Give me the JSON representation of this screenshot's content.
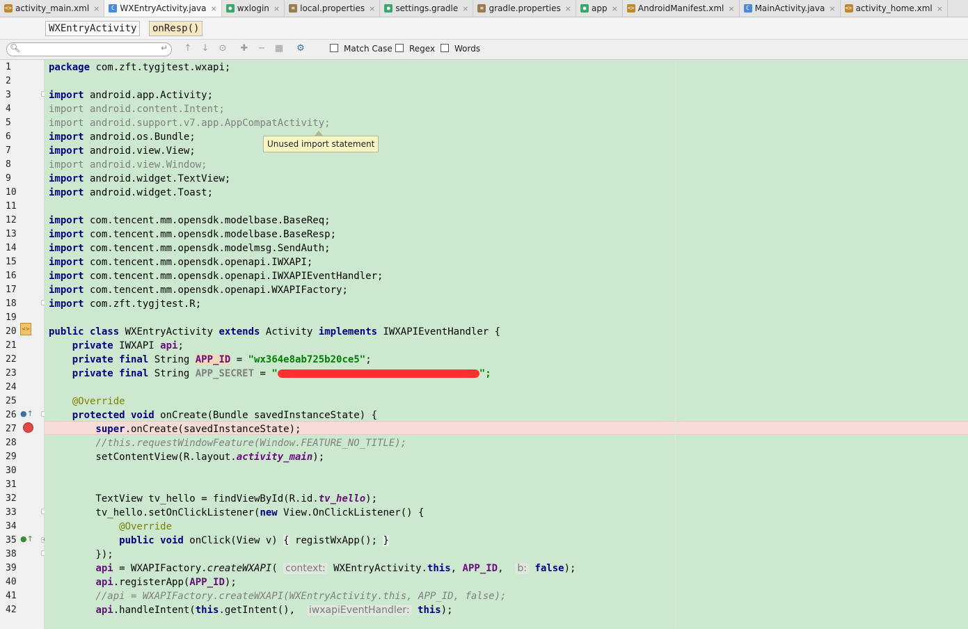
{
  "tabs": [
    {
      "label": "activity_main.xml",
      "icon": "xml-file-icon"
    },
    {
      "label": "WXEntryActivity.java",
      "icon": "java-class-icon",
      "active": true
    },
    {
      "label": "wxlogin",
      "icon": "gradle-module-icon"
    },
    {
      "label": "local.properties",
      "icon": "properties-file-icon"
    },
    {
      "label": "settings.gradle",
      "icon": "gradle-file-icon"
    },
    {
      "label": "gradle.properties",
      "icon": "properties-file-icon"
    },
    {
      "label": "app",
      "icon": "gradle-module-icon"
    },
    {
      "label": "AndroidManifest.xml",
      "icon": "manifest-file-icon"
    },
    {
      "label": "MainActivity.java",
      "icon": "java-class-icon"
    },
    {
      "label": "activity_home.xml",
      "icon": "xml-file-icon"
    }
  ],
  "breadcrumb": {
    "class_name": "WXEntryActivity",
    "method_name": "onResp()"
  },
  "findbar": {
    "search_value": "",
    "match_case_label": "Match Case",
    "regex_label": "Regex",
    "words_label": "Words",
    "match_case_checked": false,
    "regex_checked": false,
    "words_checked": false
  },
  "tooltip": "Unused import statement",
  "line_numbers": [
    "1",
    "2",
    "3",
    "4",
    "5",
    "6",
    "7",
    "8",
    "9",
    "10",
    "11",
    "12",
    "13",
    "14",
    "15",
    "16",
    "17",
    "18",
    "19",
    "20",
    "21",
    "22",
    "23",
    "24",
    "25",
    "26",
    "27",
    "28",
    "29",
    "30",
    "31",
    "32",
    "33",
    "34",
    "35",
    "38",
    "39",
    "40",
    "41",
    "42"
  ],
  "code": {
    "l1_kw": "package",
    "l1_rest": " com.zft.tygjtest.wxapi;",
    "l3_kw": "import",
    "l3_rest": " android.app.Activity;",
    "l4_kw": "import",
    "l4_rest": " android.content.Intent;",
    "l5_kw": "import",
    "l5_rest": " android.support.v7.app.AppCompatActivity;",
    "l6_kw": "import",
    "l6_rest": " android.os.Bundle;",
    "l7_kw": "import",
    "l7_rest": " android.view.View;",
    "l8_kw": "import",
    "l8_rest": " android.view.Window;",
    "l9_kw": "import",
    "l9_rest": " android.widget.TextView;",
    "l10_kw": "import",
    "l10_rest": " android.widget.Toast;",
    "l12_kw": "import",
    "l12_rest": " com.tencent.mm.opensdk.modelbase.BaseReq;",
    "l13_kw": "import",
    "l13_rest": " com.tencent.mm.opensdk.modelbase.BaseResp;",
    "l14_kw": "import",
    "l14_rest": " com.tencent.mm.opensdk.modelmsg.SendAuth;",
    "l15_kw": "import",
    "l15_rest": " com.tencent.mm.opensdk.openapi.IWXAPI;",
    "l16_kw": "import",
    "l16_rest": " com.tencent.mm.opensdk.openapi.IWXAPIEventHandler;",
    "l17_kw": "import",
    "l17_rest": " com.tencent.mm.opensdk.openapi.WXAPIFactory;",
    "l18_kw": "import",
    "l18_rest": " com.zft.tygjtest.R;",
    "l20_a": "public class",
    "l20_b": " WXEntryActivity ",
    "l20_c": "extends",
    "l20_d": " Activity ",
    "l20_e": "implements",
    "l20_f": " IWXAPIEventHandler {",
    "l21_a": "    private",
    "l21_b": " IWXAPI ",
    "l21_c": "api",
    "l21_d": ";",
    "l22_a": "    private final",
    "l22_b": " String ",
    "l22_c": "APP_ID",
    "l22_d": " = ",
    "l22_e": "\"wx364e8ab725b20ce5\"",
    "l22_f": ";",
    "l23_a": "    private final",
    "l23_b": " String ",
    "l23_c": "APP_SECRET",
    "l23_d": " = ",
    "l23_e": "\"",
    "l23_f": "\";",
    "l25": "    @Override",
    "l26_a": "    protected void",
    "l26_b": " onCreate(Bundle savedInstanceState) {",
    "l27_a": "        super",
    "l27_b": ".onCreate(savedInstanceState);",
    "l28": "        //this.requestWindowFeature(Window.FEATURE_NO_TITLE);",
    "l29_a": "        setContentView(R.layout.",
    "l29_b": "activity_main",
    "l29_c": ");",
    "l32_a": "        TextView tv_hello = findViewById(R.id.",
    "l32_b": "tv_hello",
    "l32_c": ");",
    "l33_a": "        tv_hello.setOnClickListener(",
    "l33_b": "new",
    "l33_c": " View.OnClickListener() {",
    "l34": "            @Override",
    "l35_a": "            public void",
    "l35_b": " onClick(View v) ",
    "l35_c": "{",
    "l35_d": " registWxApp(); ",
    "l35_e": "}",
    "l38": "        });",
    "l39_a": "        ",
    "l39_b": "api",
    "l39_c": " = WXAPIFactory.",
    "l39_d": "createWXAPI",
    "l39_e": "( ",
    "l39_hint1": "context:",
    "l39_f": " WXEntryActivity.",
    "l39_g": "this",
    "l39_h": ", ",
    "l39_i": "APP_ID",
    "l39_j": ",  ",
    "l39_hint2": "b:",
    "l39_k": " false",
    "l39_l": ");",
    "l40_a": "        ",
    "l40_b": "api",
    "l40_c": ".registerApp(",
    "l40_d": "APP_ID",
    "l40_e": ");",
    "l41": "        //api = WXAPIFactory.createWXAPI(WXEntryActivity.this, APP_ID, false);",
    "l42_a": "        ",
    "l42_b": "api",
    "l42_c": ".handleIntent(",
    "l42_d": "this",
    "l42_e": ".getIntent(),  ",
    "l42_hint": "iwxapiEventHandler:",
    "l42_f": " this",
    "l42_g": ");"
  },
  "colors": {
    "editor_bg": "#cce8cf",
    "keyword": "#000080",
    "string": "#008000",
    "field": "#660e7a",
    "breakpoint": "#e0484a"
  }
}
